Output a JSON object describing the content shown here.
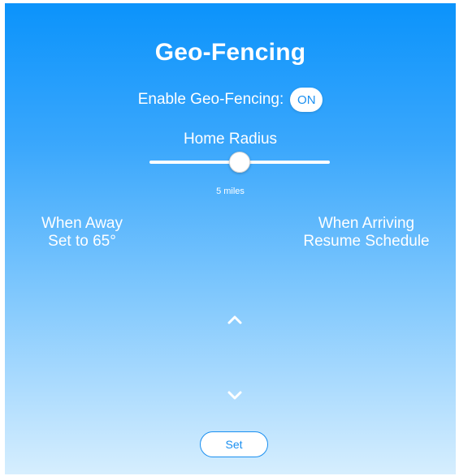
{
  "header": {
    "title": "Geo-Fencing"
  },
  "geofencing": {
    "enable_label": "Enable Geo-Fencing:",
    "toggle_state": "ON"
  },
  "radius": {
    "title": "Home Radius",
    "value_label": "5 miles",
    "slider_fraction": 0.5
  },
  "away": {
    "title": "When Away",
    "setting": "Set to 65°"
  },
  "arriving": {
    "title": "When Arriving",
    "setting": "Resume Schedule"
  },
  "icons": {
    "up": "chevron-up-icon",
    "down": "chevron-down-icon"
  },
  "actions": {
    "set_label": "Set"
  },
  "colors": {
    "gradient_top": "#0b93fb",
    "gradient_bottom": "#d6eefe",
    "accent": "#1a8ff0",
    "text": "#ffffff"
  }
}
